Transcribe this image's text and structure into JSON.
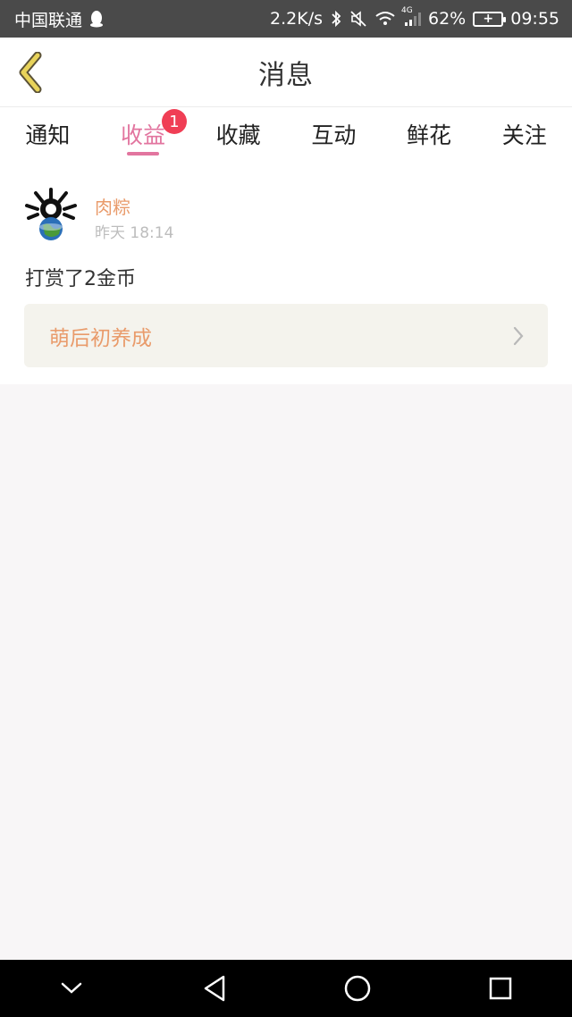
{
  "status_bar": {
    "carrier": "中国联通",
    "net_speed": "2.2K/s",
    "network_label": "4G",
    "battery": "62%",
    "time": "09:55",
    "icons": [
      "qq-penguin-icon",
      "bluetooth-icon",
      "mute-icon",
      "wifi-icon",
      "signal-icon",
      "battery-icon"
    ]
  },
  "header": {
    "title": "消息",
    "back_icon": "chevron-left-icon"
  },
  "tabs": [
    {
      "label": "通知",
      "active": false
    },
    {
      "label": "收益",
      "active": true,
      "badge": "1"
    },
    {
      "label": "收藏",
      "active": false
    },
    {
      "label": "互动",
      "active": false
    },
    {
      "label": "鲜花",
      "active": false
    },
    {
      "label": "关注",
      "active": false
    }
  ],
  "message": {
    "username": "肉粽",
    "timestamp": "昨天 18:14",
    "text": "打赏了2金币",
    "link_title": "萌后初养成",
    "link_icon": "chevron-right-icon"
  },
  "colors": {
    "accent_pink": "#e2759f",
    "username_orange": "#e99b6b",
    "badge_red": "#f03e55",
    "status_bar_bg": "#4a4a4a",
    "back_arrow_yellow": "#e8d35a"
  },
  "nav_bar": {
    "icons": [
      "collapse-down-icon",
      "back-triangle-icon",
      "home-circle-icon",
      "recents-square-icon"
    ]
  }
}
